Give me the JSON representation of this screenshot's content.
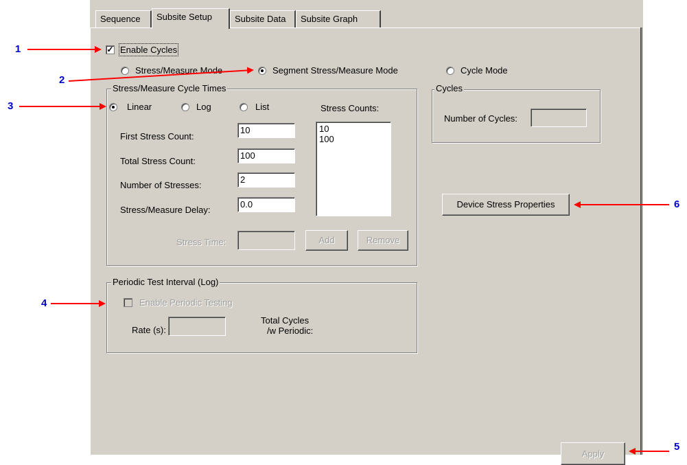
{
  "tabs": [
    "Sequence",
    "Subsite Setup",
    "Subsite Data",
    "Subsite Graph"
  ],
  "enable_cycles": {
    "label": "Enable Cycles",
    "checked": true
  },
  "modes": [
    "Stress/Measure Mode",
    "Segment Stress/Measure Mode",
    "Cycle Mode"
  ],
  "cycle_times": {
    "legend": "Stress/Measure Cycle Times",
    "scales": [
      "Linear",
      "Log",
      "List"
    ],
    "first_label": "First Stress Count:",
    "first_value": "10",
    "total_label": "Total Stress Count:",
    "total_value": "100",
    "num_label": "Number of Stresses:",
    "num_value": "2",
    "delay_label": "Stress/Measure Delay:",
    "delay_value": "0.0",
    "counts_label": "Stress Counts:",
    "counts": [
      "10",
      "100"
    ],
    "stress_time_label": "Stress Time:",
    "add_label": "Add",
    "remove_label": "Remove"
  },
  "cycles": {
    "legend": "Cycles",
    "num_label": "Number of Cycles:"
  },
  "device_stress_button": "Device Stress Properties",
  "periodic": {
    "legend": "Periodic Test Interval (Log)",
    "enable_label": "Enable Periodic Testing",
    "rate_label": "Rate (s):",
    "total_line1": "Total Cycles",
    "total_line2": "/w Periodic:"
  },
  "apply_label": "Apply",
  "callouts": [
    "1",
    "2",
    "3",
    "4",
    "5",
    "6"
  ],
  "colors": {
    "arrow": "#ff0000",
    "callout_text": "#0000cc",
    "panel": "#d4d0c8"
  }
}
